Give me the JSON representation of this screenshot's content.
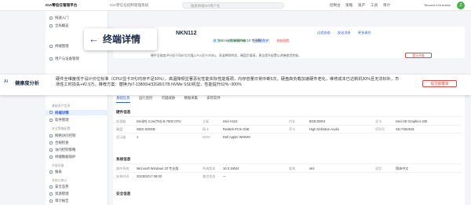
{
  "topbar": {
    "brand": "IOA零信任管理平台",
    "nav_label": "IOA零信任控制管理系统",
    "search_placeholder": "搜索终端/IP/用户名",
    "menu": [
      "控制台",
      "策略",
      "资产",
      "工具",
      "审计"
    ],
    "avatar_letter": "Z",
    "user_name": "Tencent IOA Admin"
  },
  "sidebar": {
    "title": "终端详情",
    "items": [
      {
        "label": "快速入门",
        "active": false
      },
      {
        "label": "全局概览",
        "active": false
      },
      {
        "label": "终端管理",
        "active": false
      },
      {
        "label": "用户与设备管理",
        "active": false
      },
      {
        "label": "终端详情",
        "active": true
      },
      {
        "label": "软件管理",
        "active": false
      },
      {
        "label": "网络访问控制",
        "active": false
      },
      {
        "label": "合规检查",
        "active": false
      },
      {
        "label": "访问控制策略",
        "active": false
      },
      {
        "label": "终端数据保护",
        "active": false
      },
      {
        "label": "报表",
        "active": false
      },
      {
        "label": "安全态势",
        "active": false
      },
      {
        "label": "资源管理",
        "active": false
      },
      {
        "label": "审计报告",
        "active": false
      },
      {
        "label": "系统设置",
        "active": false
      }
    ],
    "sections": [
      "基础资产信息",
      "安全策略配置",
      "外接设备",
      "系统与审计"
    ]
  },
  "callout": {
    "arrow": "←",
    "title": "终端详情"
  },
  "device": {
    "name": "NKN112",
    "chips": [
      {
        "text": "在线",
        "tone": "g"
      },
      {
        "text": "已安装客户端",
        "tone": "g"
      },
      {
        "text": "已开启防护",
        "tone": "b"
      },
      {
        "text": "存在风险",
        "tone": "r"
      }
    ],
    "os": "Microsoft Windows 10 专业版",
    "actions": [
      "远程协助",
      "发送消息",
      "更多操作"
    ],
    "desc": "硬件全维度评分低于同价位均值(CPU/显卡/内存)，高温降频明显，硬盘负载高，建议提升配置以改善使用性能。",
    "upgrade_btn": "提示升级"
  },
  "health": {
    "badge": "AI",
    "title": "健康度分析",
    "text": "硬件全维度低于设计价位标准（CPU/显卡3代/内存不足50%），高温降频显著恶化性能实际性能瓶颈，内存容量日常中断5次。硬盘高负载加速硬件老化，维修成本已达新机30%且无法标补，市场性工时损失+¥2.5万。推荐方案：替换为i7-13800H/32GB/1TB NVMe SSD机型，性能提升52%~300%",
    "button": "提交部署单"
  },
  "tabs": [
    "基础信息",
    "运行监控",
    "可疑威胁",
    "数据采集",
    "安装软件"
  ],
  "basic": {
    "title": "硬件信息",
    "rows": [
      [
        {
          "k": "处理器",
          "v": "Intel(R) Core(TM) i5-7500 CPU"
        },
        {
          "k": "主板",
          "v": "Intel H110"
        },
        {
          "k": "内存",
          "v": "8GB DDR4"
        },
        {
          "k": "显卡",
          "v": "Intel HD Graphics 630"
        }
      ],
      [
        {
          "k": "硬盘",
          "v": "WDC 500GB"
        },
        {
          "k": "网卡",
          "v": "Realtek PCIe GbE"
        },
        {
          "k": "声卡",
          "v": "High Definition Audio"
        },
        {
          "k": "序列号",
          "v": "SN-7X82K91"
        }
      ],
      [
        {
          "k": "显示器",
          "v": "1"
        },
        {
          "k": "BIOS",
          "v": "Dell Apple/ WAIDM"
        },
        {
          "k": "",
          "v": ""
        },
        {
          "k": "",
          "v": ""
        }
      ]
    ]
  },
  "system": {
    "title": "系统信息",
    "rows": [
      [
        {
          "k": "操作系统",
          "v": "Microsoft Windows 10 专业版"
        },
        {
          "k": "系统版本",
          "v": "10.0.19044"
        },
        {
          "k": "架构",
          "v": "x64"
        },
        {
          "k": "语言",
          "v": "简体中文"
        }
      ],
      [
        {
          "k": "安装时间",
          "v": "2023/02/17 09:00"
        },
        {
          "k": "激活状态",
          "v": "—"
        },
        {
          "k": "",
          "v": ""
        },
        {
          "k": "",
          "v": ""
        }
      ]
    ]
  },
  "security": {
    "title": "安全信息"
  }
}
